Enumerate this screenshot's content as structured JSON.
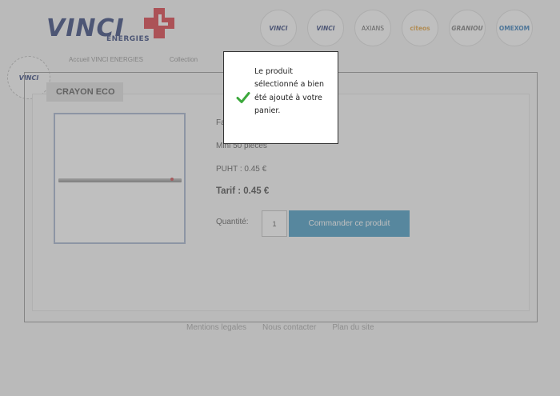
{
  "header": {
    "logo_text": "VINCI",
    "logo_subtext": "ENERGIES",
    "brands": [
      "VINCI",
      "VINCI",
      "AXIANS",
      "citeos",
      "GRANIOU",
      "OMEXOM"
    ],
    "side_logo": "VINCI"
  },
  "nav": {
    "items": [
      "Accueil VINCI ENERGIES",
      "Collection"
    ]
  },
  "product": {
    "title": "CRAYON ECO",
    "line1": "Fa",
    "line2": "Mini 50 pièces",
    "puht": "PUHT : 0.45 €",
    "tarif": "Tarif : 0.45 €",
    "quantity_label": "Quantité:",
    "quantity_value": "1",
    "order_button": "Commander ce produit"
  },
  "footer": {
    "links": [
      "Mentions legales",
      "Nous contacter",
      "Plan du site"
    ]
  },
  "modal": {
    "message": "Le produit sélectionné a bien été ajouté à votre panier.",
    "icon": "check-icon"
  },
  "colors": {
    "brand_navy": "#1a2d6b",
    "brand_red": "#d8242f",
    "order_button": "#2f8fbc",
    "check_green": "#3ca83c"
  }
}
